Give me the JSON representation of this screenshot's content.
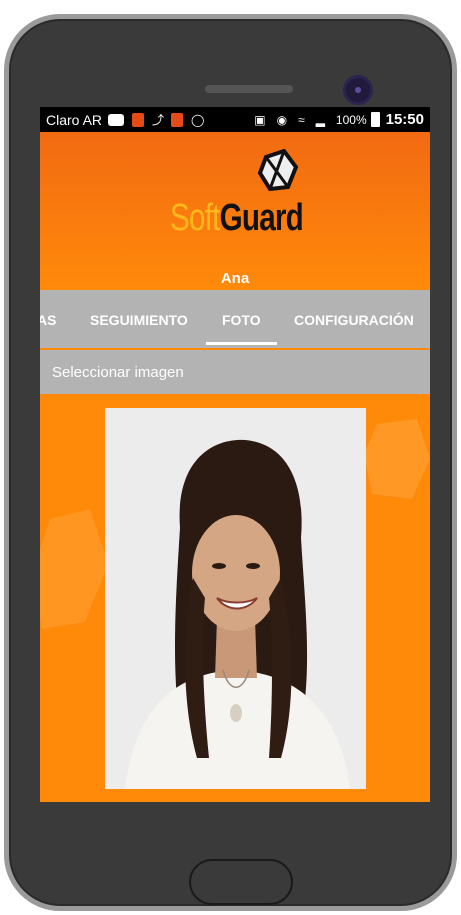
{
  "status_bar": {
    "carrier": "Claro AR",
    "battery_pct": "100%",
    "time": "15:50"
  },
  "header": {
    "logo_soft": "Soft",
    "logo_guard": "Guard",
    "user_name": "Ana"
  },
  "tabs": [
    {
      "label": "AS"
    },
    {
      "label": "SEGUIMIENTO"
    },
    {
      "label": "FOTO",
      "active": true
    },
    {
      "label": "CONFIGURACIÓN"
    }
  ],
  "action_bar": {
    "label": "Seleccionar imagen"
  },
  "colors": {
    "accent_orange": "#ff8a0a",
    "tab_gray": "#b3b3b3",
    "logo_yellow": "#ffb81c"
  }
}
